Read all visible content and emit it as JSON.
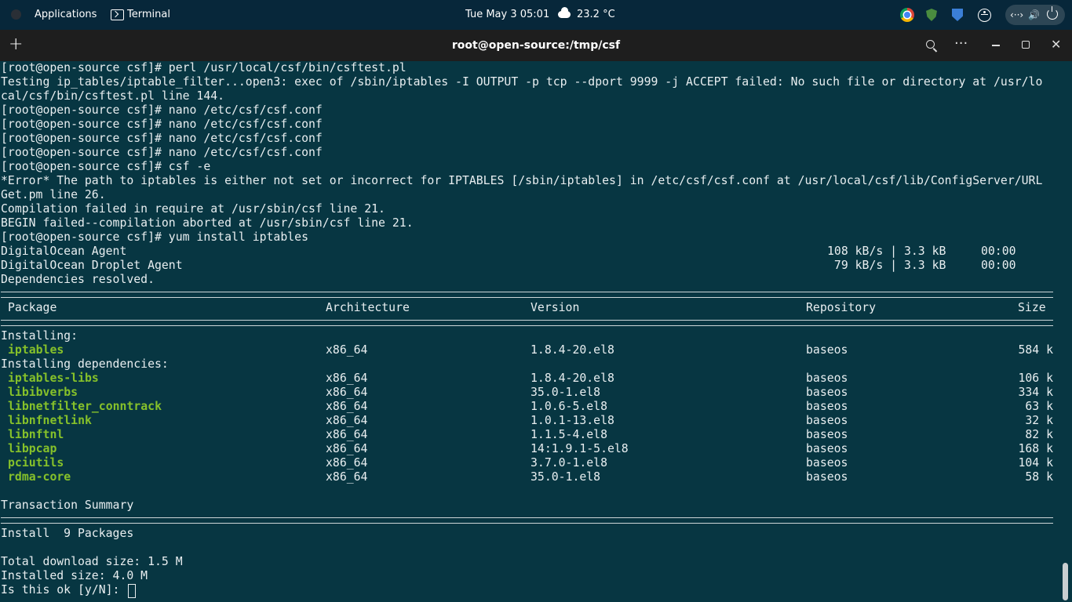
{
  "topbar": {
    "applications": "Applications",
    "terminal": "Terminal",
    "clock": "Tue May 3  05:01",
    "temperature": "23.2 °C",
    "network_glyph": "‹··›",
    "volume_glyph": "🔊"
  },
  "window": {
    "title": "root@open-source:/tmp/csf",
    "new_tab": "+",
    "menu": "···",
    "close": "✕"
  },
  "terminal": {
    "lines_top": [
      "[root@open-source csf]# perl /usr/local/csf/bin/csftest.pl",
      "Testing ip_tables/iptable_filter...open3: exec of /sbin/iptables -I OUTPUT -p tcp --dport 9999 -j ACCEPT failed: No such file or directory at /usr/lo",
      "cal/csf/bin/csftest.pl line 144.",
      "[root@open-source csf]# nano /etc/csf/csf.conf",
      "[root@open-source csf]# nano /etc/csf/csf.conf",
      "[root@open-source csf]# nano /etc/csf/csf.conf",
      "[root@open-source csf]# nano /etc/csf/csf.conf",
      "[root@open-source csf]# csf -e",
      "*Error* The path to iptables is either not set or incorrect for IPTABLES [/sbin/iptables] in /etc/csf/csf.conf at /usr/local/csf/lib/ConfigServer/URL",
      "Get.pm line 26.",
      "Compilation failed in require at /usr/sbin/csf line 21.",
      "BEGIN failed--compilation aborted at /usr/sbin/csf line 21.",
      "[root@open-source csf]# yum install iptables"
    ],
    "repos": [
      {
        "name": "DigitalOcean Agent",
        "stats": "108 kB/s | 3.3 kB     00:00"
      },
      {
        "name": "DigitalOcean Droplet Agent",
        "stats": " 79 kB/s | 3.3 kB     00:00"
      }
    ],
    "deps_resolved": "Dependencies resolved.",
    "headers": {
      "package": "Package",
      "arch": "Architecture",
      "version": "Version",
      "repo": "Repository",
      "size": "Size"
    },
    "installing_label": "Installing:",
    "installing": [
      {
        "name": "iptables",
        "arch": "x86_64",
        "version": "1.8.4-20.el8",
        "repo": "baseos",
        "size": "584 k"
      }
    ],
    "deps_label": "Installing dependencies:",
    "dependencies": [
      {
        "name": "iptables-libs",
        "arch": "x86_64",
        "version": "1.8.4-20.el8",
        "repo": "baseos",
        "size": "106 k"
      },
      {
        "name": "libibverbs",
        "arch": "x86_64",
        "version": "35.0-1.el8",
        "repo": "baseos",
        "size": "334 k"
      },
      {
        "name": "libnetfilter_conntrack",
        "arch": "x86_64",
        "version": "1.0.6-5.el8",
        "repo": "baseos",
        "size": "63 k"
      },
      {
        "name": "libnfnetlink",
        "arch": "x86_64",
        "version": "1.0.1-13.el8",
        "repo": "baseos",
        "size": "32 k"
      },
      {
        "name": "libnftnl",
        "arch": "x86_64",
        "version": "1.1.5-4.el8",
        "repo": "baseos",
        "size": "82 k"
      },
      {
        "name": "libpcap",
        "arch": "x86_64",
        "version": "14:1.9.1-5.el8",
        "repo": "baseos",
        "size": "168 k"
      },
      {
        "name": "pciutils",
        "arch": "x86_64",
        "version": "3.7.0-1.el8",
        "repo": "baseos",
        "size": "104 k"
      },
      {
        "name": "rdma-core",
        "arch": "x86_64",
        "version": "35.0-1.el8",
        "repo": "baseos",
        "size": "58 k"
      }
    ],
    "transaction_summary": "Transaction Summary",
    "install_count": "Install  9 Packages",
    "total_download": "Total download size: 1.5 M",
    "installed_size": "Installed size: 4.0 M",
    "prompt": "Is this ok [y/N]: "
  },
  "colors": {
    "terminal_bg": "#073642",
    "package_green": "#86c12a",
    "topbar_bg": "#07273a",
    "header_bg": "#1e1e1e"
  }
}
